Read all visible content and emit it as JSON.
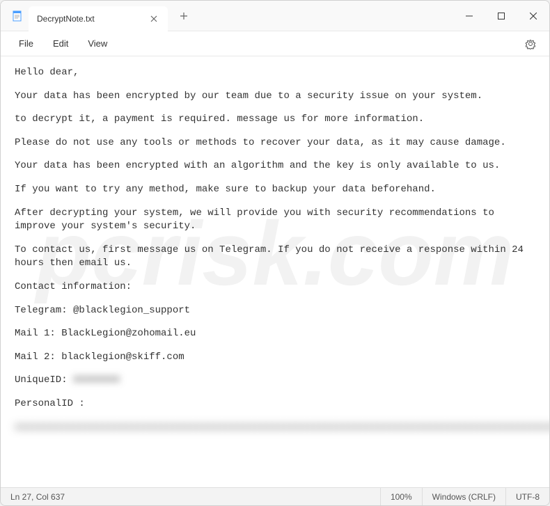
{
  "window": {
    "tab_title": "DecryptNote.txt"
  },
  "menu": {
    "file": "File",
    "edit": "Edit",
    "view": "View"
  },
  "body": {
    "p1": "Hello dear,",
    "p2": "Your data has been encrypted by our team due to a security issue on your system.",
    "p3": "to decrypt it, a payment is required. message us for more information.",
    "p4": "Please do not use any tools or methods to recover your data, as it may cause damage.",
    "p5": "Your data has been encrypted with an algorithm and the key is only available to us.",
    "p6": "If you want to try any method, make sure to backup your data beforehand.",
    "p7": "After decrypting your system, we will provide you with security recommendations to improve your system's security.",
    "p8": "To contact us, first message us on Telegram. If you do not receive a response within 24 hours then email us.",
    "p9": "Contact information:",
    "p10": "Telegram: @blacklegion_support",
    "p11": "Mail 1: BlackLegion@zohomail.eu",
    "p12": "Mail 2: blacklegion@skiff.com",
    "p13_prefix": "UniqueID: ",
    "p13_hidden": "XXXXXXXX",
    "p14": "PersonalID :",
    "p15_hidden": "xxxxxxxxxxxxxxxxxxxxxxxxxxxxxxxxxxxxxxxxxxxxxxxxxxxxxxxxxxxxxxxxxxxxxxxxxxxxxxxxxxxxxxxxxxxxxxxxxxxxxxxxxxxxxxxxxxxxxxxxxxxxxxxxxxxxxxxxxxxxxxxxxxxxxxxxxxxxxxxxxxxxxxxxxxxxxxxxxxxxxxxxxxxxxxxxxxxxxxxxxxxxxxxx"
  },
  "status": {
    "position": "Ln 27, Col 637",
    "zoom": "100%",
    "line_ending": "Windows (CRLF)",
    "encoding": "UTF-8"
  },
  "watermark": "pcrisk.com"
}
